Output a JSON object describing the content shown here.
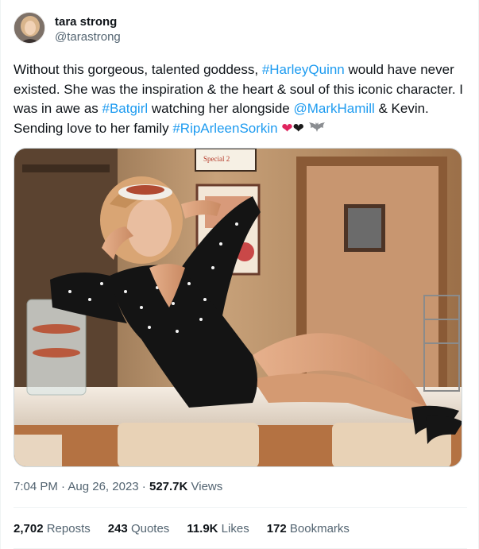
{
  "author": {
    "display_name": "tara strong",
    "handle": "@tarastrong"
  },
  "tweet": {
    "segments": [
      {
        "text": "Without this gorgeous, talented goddess, ",
        "type": "text"
      },
      {
        "text": "#HarleyQuinn",
        "type": "link"
      },
      {
        "text": " would have never existed. She was the inspiration & the heart & soul of this iconic character. I was in awe as ",
        "type": "text"
      },
      {
        "text": "#Batgirl",
        "type": "link"
      },
      {
        "text": " watching her alongside ",
        "type": "text"
      },
      {
        "text": "@MarkHamill",
        "type": "link"
      },
      {
        "text": " & Kevin. Sending love to her family ",
        "type": "text"
      },
      {
        "text": "#RipArleenSorkin",
        "type": "link"
      }
    ],
    "emoji": [
      "red-heart",
      "black-heart",
      "bat"
    ]
  },
  "media": {
    "sign_text": "Special 2"
  },
  "meta": {
    "time": "7:04 PM",
    "sep1": " · ",
    "date": "Aug 26, 2023",
    "sep2": " · ",
    "views_count": "527.7K",
    "views_label": " Views"
  },
  "stats": {
    "reposts_count": "2,702",
    "reposts_label": " Reposts",
    "quotes_count": "243",
    "quotes_label": " Quotes",
    "likes_count": "11.9K",
    "likes_label": " Likes",
    "bookmarks_count": "172",
    "bookmarks_label": " Bookmarks"
  },
  "colors": {
    "link": "#1d9bf0",
    "text": "#0f1419",
    "secondary": "#536471"
  }
}
